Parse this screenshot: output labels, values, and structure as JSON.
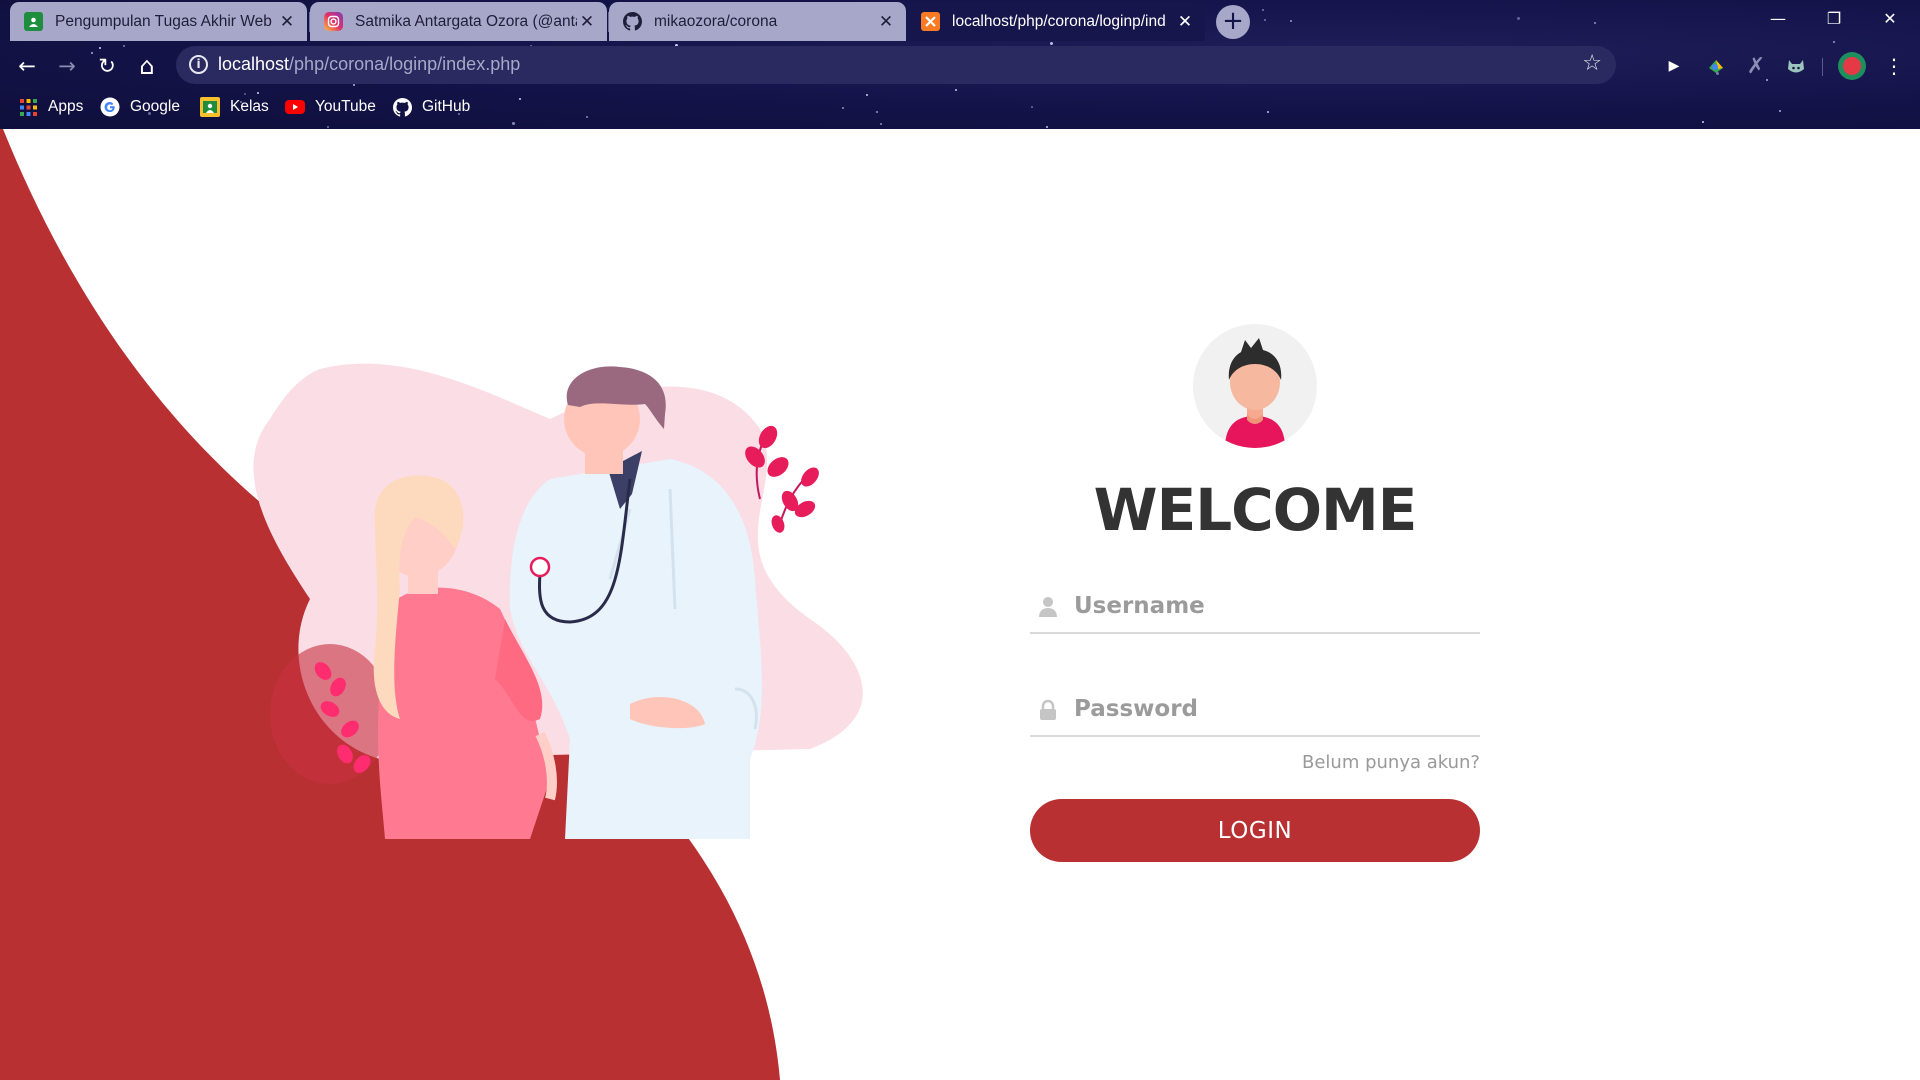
{
  "browser": {
    "tabs": [
      {
        "title": "Pengumpulan Tugas Akhir Web",
        "icon": "google-classroom-icon",
        "active": false
      },
      {
        "title": "Satmika Antargata Ozora (@anta",
        "icon": "instagram-icon",
        "active": false
      },
      {
        "title": "mikaozora/corona",
        "icon": "github-icon",
        "active": false
      },
      {
        "title": "localhost/php/corona/loginp/ind",
        "icon": "xampp-icon",
        "active": true
      }
    ],
    "close_glyph": "✕",
    "new_tab_glyph": "+",
    "window_controls": {
      "minimize": "—",
      "restore": "❐",
      "close": "✕"
    },
    "nav": {
      "back": "←",
      "forward": "→",
      "reload": "↻",
      "home": "⌂"
    },
    "address": {
      "host": "localhost",
      "path": "/php/corona/loginp/index.php",
      "info_glyph": "i",
      "bookmark_glyph": "☆"
    },
    "bookmarks": [
      {
        "label": "Apps",
        "icon": "apps-grid-icon"
      },
      {
        "label": "Google",
        "icon": "google-icon"
      },
      {
        "label": "Kelas",
        "icon": "google-classroom-icon"
      },
      {
        "label": "YouTube",
        "icon": "youtube-icon"
      },
      {
        "label": "GitHub",
        "icon": "github-icon"
      }
    ]
  },
  "login": {
    "heading": "WELCOME",
    "username_placeholder": "Username",
    "password_placeholder": "Password",
    "register_link": "Belum punya akun?",
    "submit_label": "LOGIN"
  },
  "colors": {
    "accent": "#b83032",
    "chrome_bg": "#14134a",
    "inactive_tab": "#a7a7c9"
  }
}
